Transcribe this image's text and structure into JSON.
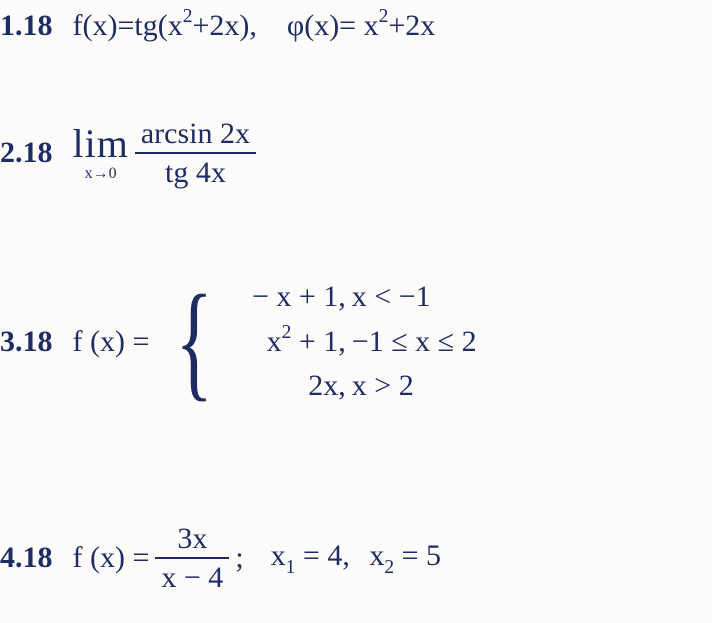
{
  "p1": {
    "num": "1.18",
    "lhs": "f(x)=tg(x",
    "sup1": "2",
    "mid": "+2x),",
    "phi": "φ(x)= x",
    "sup2": "2",
    "tail": "+2x"
  },
  "p2": {
    "num": "2.18",
    "lim_top": "lim",
    "lim_bot": "x→0",
    "frac_num": "arcsin 2x",
    "frac_den": "tg 4x"
  },
  "p3": {
    "num": "3.18",
    "lhs": "f (x) =",
    "c1_expr_a": "− x + 1,",
    "c1_cond": "x < −1",
    "c2_expr_a": "x",
    "c2_expr_sup": "2",
    "c2_expr_b": " + 1,",
    "c2_cond": "−1 ≤ x ≤ 2",
    "c3_expr_a": "2x,",
    "c3_cond": "x > 2"
  },
  "p4": {
    "num": "4.18",
    "lhs": "f (x) =",
    "frac_num": "3x",
    "frac_den": "x − 4",
    "semi": ";",
    "x1_a": "x",
    "x1_sub": "1",
    "x1_b": " = 4,",
    "x2_a": "x",
    "x2_sub": "2",
    "x2_b": " = 5"
  }
}
